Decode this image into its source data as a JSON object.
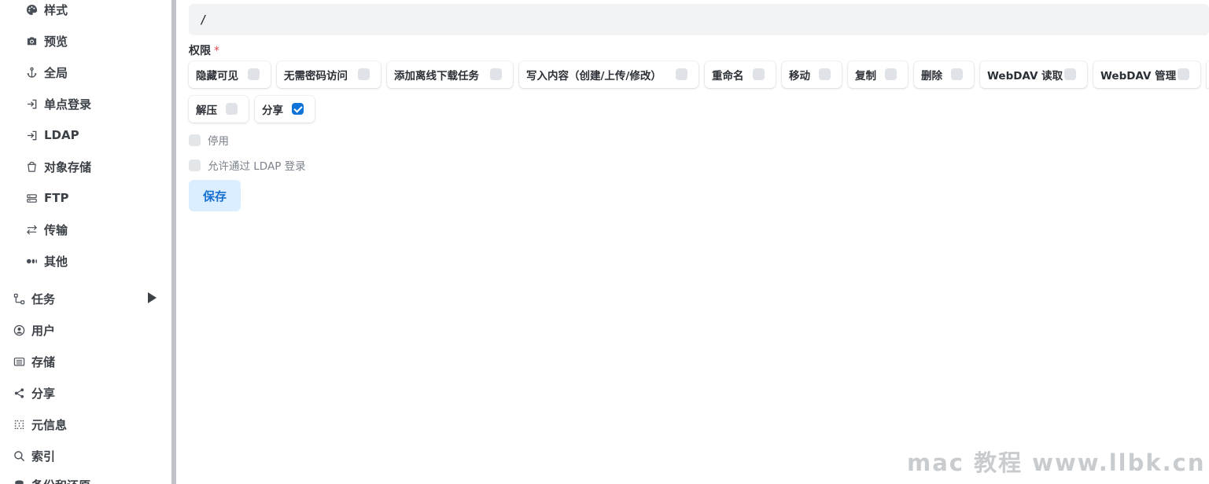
{
  "sidebar": {
    "sub_items": [
      {
        "label": "样式"
      },
      {
        "label": "预览"
      },
      {
        "label": "全局"
      },
      {
        "label": "单点登录"
      },
      {
        "label": "LDAP"
      },
      {
        "label": "对象存储"
      },
      {
        "label": "FTP"
      },
      {
        "label": "传输"
      },
      {
        "label": "其他"
      }
    ],
    "top_items": [
      {
        "label": "任务"
      },
      {
        "label": "用户"
      },
      {
        "label": "存储"
      },
      {
        "label": "分享"
      },
      {
        "label": "元信息"
      },
      {
        "label": "索引"
      },
      {
        "label": "备份和还原"
      }
    ]
  },
  "form": {
    "path_value": "/",
    "permissions_label": "权限",
    "required_mark": "*",
    "permissions": [
      {
        "label": "隐藏可见",
        "checked": false
      },
      {
        "label": "无需密码访问",
        "checked": false
      },
      {
        "label": "添加离线下载任务",
        "checked": false
      },
      {
        "label": "写入内容（创建/上传/修改）",
        "checked": false
      },
      {
        "label": "重命名",
        "checked": false
      },
      {
        "label": "移动",
        "checked": false
      },
      {
        "label": "复制",
        "checked": false
      },
      {
        "label": "删除",
        "checked": false
      },
      {
        "label": "WebDAV 读取",
        "checked": false
      },
      {
        "label": "WebDAV 管理",
        "checked": false
      },
      {
        "label": "解压",
        "checked": false
      },
      {
        "label": "分享",
        "checked": true
      }
    ],
    "disable_label": "停用",
    "ldap_login_label": "允许通过 LDAP 登录",
    "save_label": "保存"
  },
  "watermark": "mac 教程 www.llbk.cn",
  "colors": {
    "accent": "#0e74d8",
    "save_bg": "#dbeeff",
    "required": "#e5484d"
  }
}
